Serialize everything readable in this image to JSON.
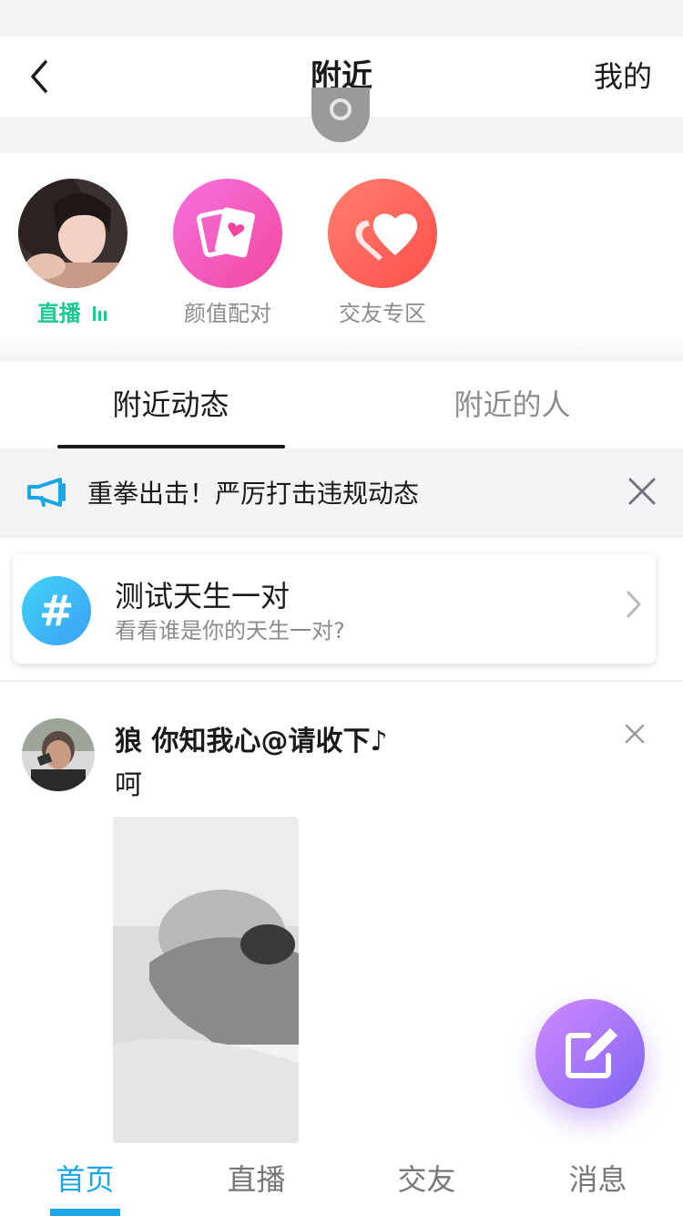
{
  "navbar": {
    "title": "附近",
    "right_label": "我的"
  },
  "shortcuts": [
    {
      "label": "直播",
      "icon": "live-bars-icon"
    },
    {
      "label": "颜值配对",
      "icon": "cards-heart-icon"
    },
    {
      "label": "交友专区",
      "icon": "hearts-icon"
    }
  ],
  "tabs": [
    {
      "label": "附近动态",
      "active": true
    },
    {
      "label": "附近的人",
      "active": false
    }
  ],
  "notice": {
    "text": "重拳出击！严厉打击违规动态"
  },
  "test_card": {
    "title": "测试天生一对",
    "subtitle": "看看谁是你的天生一对?"
  },
  "post": {
    "author": "狼 你知我心@请收下♪",
    "text": "呵"
  },
  "bottom_nav": [
    {
      "label": "首页",
      "active": true
    },
    {
      "label": "直播",
      "active": false
    },
    {
      "label": "交友",
      "active": false
    },
    {
      "label": "消息",
      "active": false
    }
  ],
  "colors": {
    "accent": "#1aa7e8",
    "live_green": "#1fc98e",
    "pink": "#f65ad1",
    "coral": "#ff6a5e",
    "fab": "#a978f7"
  }
}
